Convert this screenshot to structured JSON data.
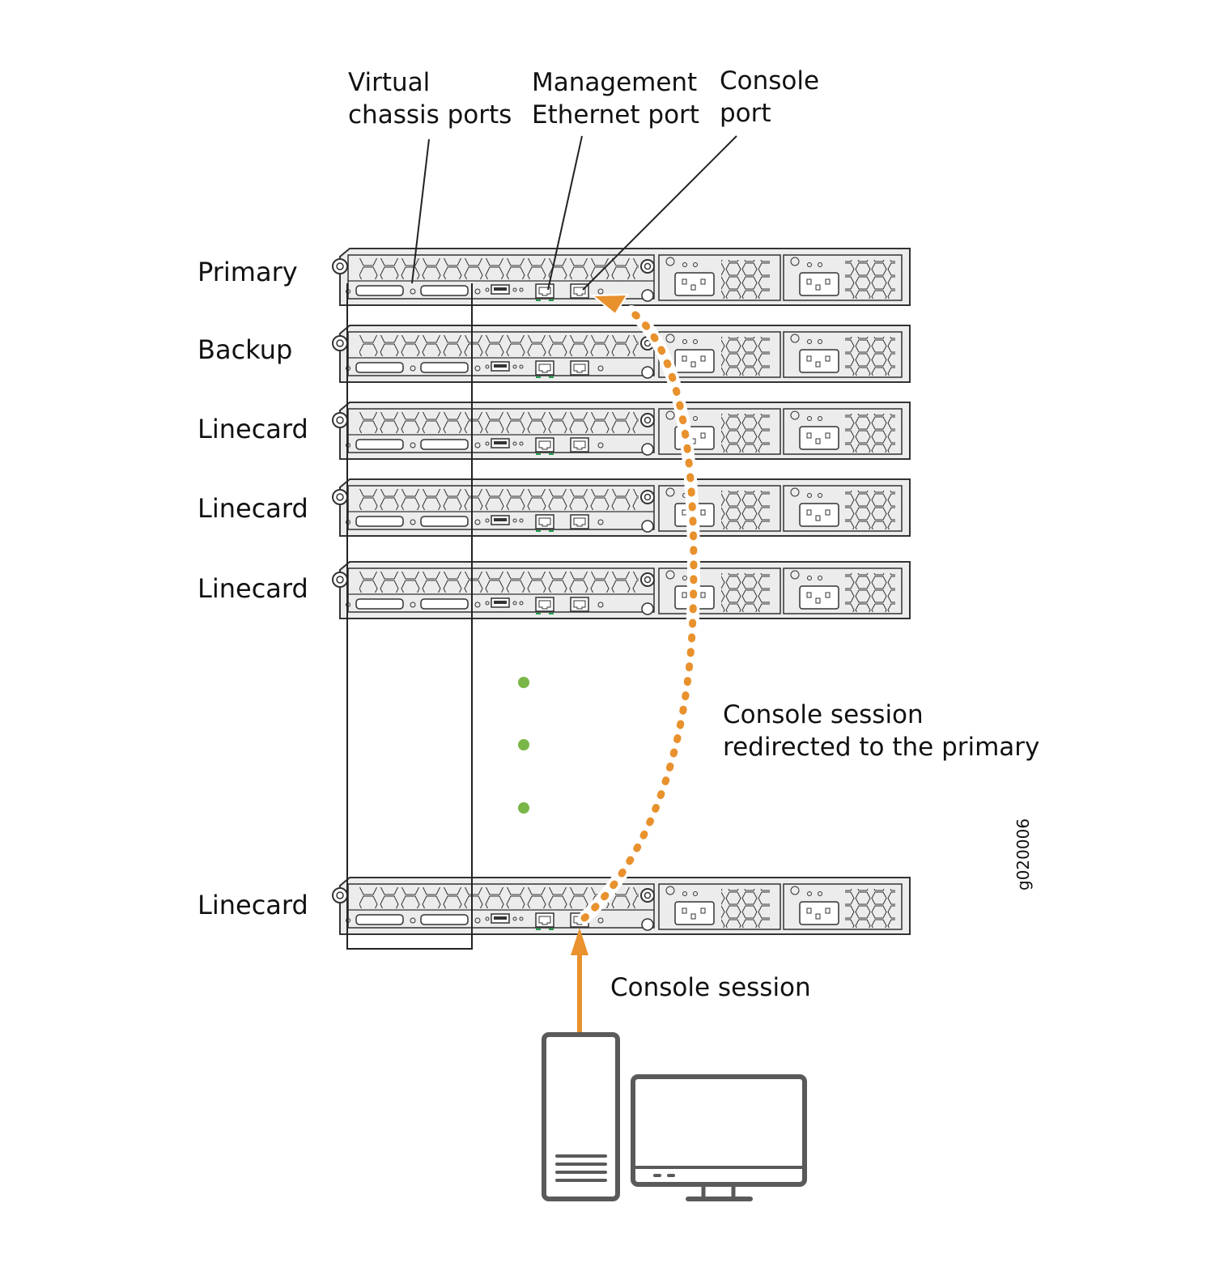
{
  "callouts": {
    "vc_ports": [
      "Virtual",
      "chassis ports"
    ],
    "mgmt_port": [
      "Management",
      "Ethernet port"
    ],
    "console_port": [
      "Console",
      "port"
    ]
  },
  "switches": [
    {
      "role": "Primary"
    },
    {
      "role": "Backup"
    },
    {
      "role": "Linecard"
    },
    {
      "role": "Linecard"
    },
    {
      "role": "Linecard"
    },
    {
      "role": "Linecard"
    }
  ],
  "annotations": {
    "redirected": [
      "Console session",
      "redirected to the primary"
    ],
    "console_session": "Console session"
  },
  "figure_id": "g020006",
  "colors": {
    "accent": "#e8912d",
    "ellipsis_dot": "#7ab648",
    "led": "#1f9f4a",
    "chassis_fill": "#ececec",
    "stroke": "#333333",
    "pc_stroke": "#5a5a5a"
  }
}
